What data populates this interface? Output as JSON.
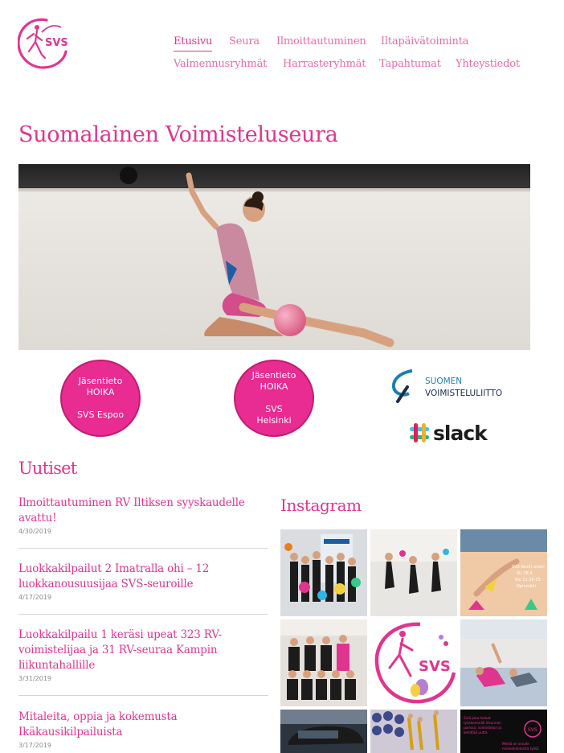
{
  "site": {
    "logo_text": "SVS",
    "title": "Suomalainen Voimisteluseura"
  },
  "nav": {
    "items": [
      {
        "label": "Etusivu",
        "active": true
      },
      {
        "label": "Seura"
      },
      {
        "label": "Ilmoittautuminen"
      },
      {
        "label": "Iltapäivätoiminta"
      },
      {
        "label": "Valmennusryhmät"
      },
      {
        "label": "Harrasteryhmät"
      },
      {
        "label": "Tapahtumat"
      },
      {
        "label": "Yhteystiedot"
      }
    ]
  },
  "links": [
    {
      "line1": "Jäsentieto",
      "line2": "HOIKA",
      "line3": "SVS Espoo"
    },
    {
      "line1": "Jäsentieto",
      "line2": "HOIKA",
      "line3": "SVS",
      "line4": "Helsinki"
    }
  ],
  "partners": {
    "sv_line1": "SUOMEN",
    "sv_line2": "VOIMISTELULIITTO",
    "slack": "slack"
  },
  "news": {
    "heading": "Uutiset",
    "items": [
      {
        "title": "Ilmoittautuminen RV Iltiksen syyskaudelle avattu!",
        "date": "4/30/2019"
      },
      {
        "title": "Luokkakilpailut 2 Imatralla ohi – 12 luokkanousuusijaa SVS-seuroille",
        "date": "4/17/2019"
      },
      {
        "title": "Luokkakilpailu 1 keräsi upeat 323 RV-voimistelijaa ja 31 RV-seuraa Kampin liikuntahallille",
        "date": "3/31/2019"
      },
      {
        "title": "Mitaleita, oppia ja kokemusta Ikäkausikilpailuista",
        "date": "3/17/2019"
      }
    ]
  },
  "instagram": {
    "heading": "Instagram",
    "tile3_text": [
      "SVS Kevät avoin",
      "SU 28.4.",
      "Klo 11.30-15",
      "Opinmäki"
    ],
    "tile9_text": [
      "Sinä joka haluat",
      "työskennellä liikunnan",
      "parissa, voimistelun ja",
      "kehittää uutta",
      "Meillä on sinulle",
      "mielenkiintoista työtä"
    ],
    "logo_text": "SVS"
  },
  "colors": {
    "brand": "#e0358f",
    "nav": "#ec6aa9",
    "circle": "#e82c91",
    "date": "#8a8a8a",
    "sv_blue": "#1a7fb5"
  }
}
